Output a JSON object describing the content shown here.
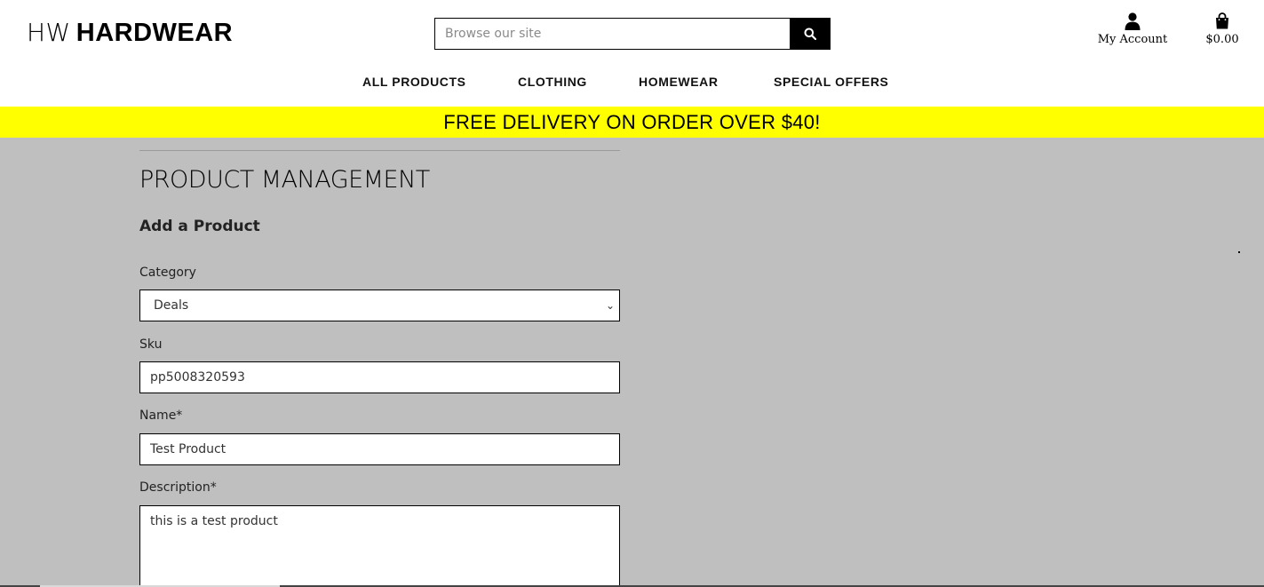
{
  "header": {
    "logo_light": "HW",
    "logo_bold": "HARDWEAR",
    "search_placeholder": "Browse our site",
    "account_label": "My Account",
    "cart_total": "$0.00"
  },
  "nav": [
    {
      "label": "ALL PRODUCTS"
    },
    {
      "label": "CLOTHING"
    },
    {
      "label": "HOMEWEAR"
    },
    {
      "label": "SPECIAL OFFERS"
    }
  ],
  "banner": "FREE DELIVERY ON ORDER OVER $40!",
  "main": {
    "title": "PRODUCT MANAGEMENT",
    "subtitle": "Add a Product",
    "form": {
      "category_label": "Category",
      "category_value": "Deals",
      "sku_label": "Sku",
      "sku_value": "pp5008320593",
      "name_label": "Name*",
      "name_value": "Test Product",
      "description_label": "Description*",
      "description_value": "this is a test product"
    }
  },
  "colors": {
    "banner": "#ffff00",
    "page_background": "#bfbfbf",
    "header_background": "#ffffff",
    "search_button": "#000000"
  },
  "icons": [
    "search-icon",
    "user-icon",
    "shopping-bag-icon",
    "chevron-down-icon"
  ]
}
